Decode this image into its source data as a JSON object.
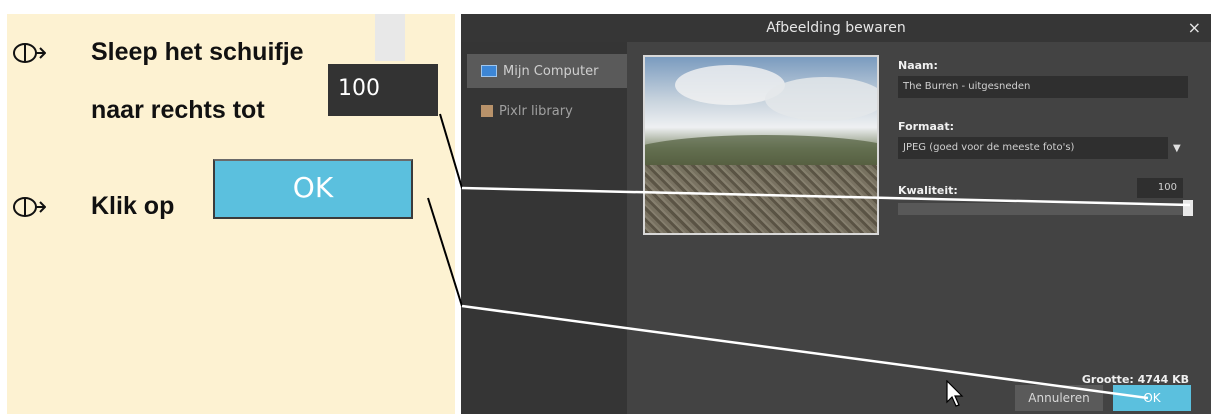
{
  "instructions": {
    "step1_line1": "Sleep het schuifje",
    "step1_line2": "naar rechts tot",
    "step1_value": "100",
    "step2_prefix": "Klik op",
    "step2_button": "OK"
  },
  "dialog": {
    "title": "Afbeelding bewaren",
    "close": "×",
    "sidebar": [
      {
        "label": "Mijn Computer",
        "icon": "monitor-icon",
        "active": true
      },
      {
        "label": "Pixlr library",
        "icon": "library-icon",
        "active": false
      }
    ],
    "name_label": "Naam:",
    "name_value": "The Burren - uitgesneden",
    "format_label": "Formaat:",
    "format_value": "JPEG (goed voor de meeste foto's)",
    "quality_label": "Kwaliteit:",
    "quality_value": "100",
    "size_label": "Grootte: 4744 KB",
    "cancel_label": "Annuleren",
    "ok_label": "OK"
  },
  "colors": {
    "panel_bg": "#fdf2d2",
    "dialog_bg": "#434343",
    "accent_button": "#5bc0de"
  },
  "quality_slider_fraction": 1.0
}
